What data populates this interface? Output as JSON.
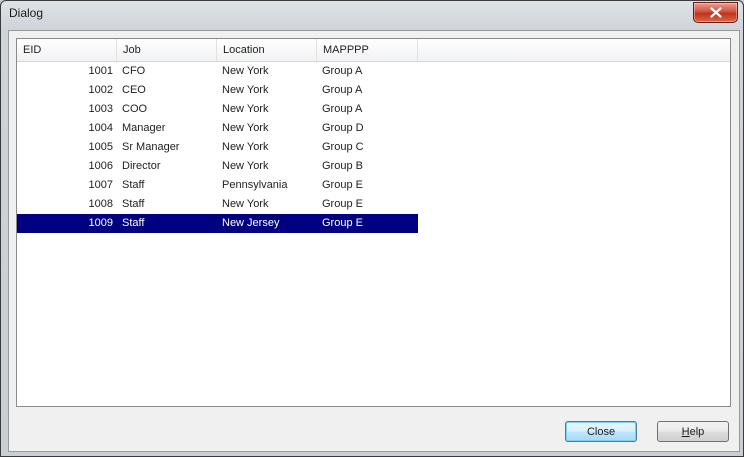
{
  "window": {
    "title": "Dialog"
  },
  "table": {
    "columns": [
      "EID",
      "Job",
      "Location",
      "MAPPPP"
    ],
    "rows": [
      {
        "eid": "1001",
        "job": "CFO",
        "location": "New York",
        "mapppp": "Group A",
        "selected": false
      },
      {
        "eid": "1002",
        "job": "CEO",
        "location": "New York",
        "mapppp": "Group A",
        "selected": false
      },
      {
        "eid": "1003",
        "job": "COO",
        "location": "New York",
        "mapppp": "Group A",
        "selected": false
      },
      {
        "eid": "1004",
        "job": "Manager",
        "location": "New York",
        "mapppp": "Group D",
        "selected": false
      },
      {
        "eid": "1005",
        "job": "Sr Manager",
        "location": "New York",
        "mapppp": "Group C",
        "selected": false
      },
      {
        "eid": "1006",
        "job": "Director",
        "location": "New York",
        "mapppp": "Group B",
        "selected": false
      },
      {
        "eid": "1007",
        "job": "Staff",
        "location": "Pennsylvania",
        "mapppp": "Group E",
        "selected": false
      },
      {
        "eid": "1008",
        "job": "Staff",
        "location": "New York",
        "mapppp": "Group E",
        "selected": false
      },
      {
        "eid": "1009",
        "job": "Staff",
        "location": "New Jersey",
        "mapppp": "Group E",
        "selected": true
      }
    ]
  },
  "buttons": {
    "close_label": "Close",
    "help_first": "H",
    "help_rest": "elp"
  },
  "icons": {
    "window_close": "close-x-icon"
  },
  "colors": {
    "selection": "#000080",
    "window_close": "#c7422b"
  }
}
